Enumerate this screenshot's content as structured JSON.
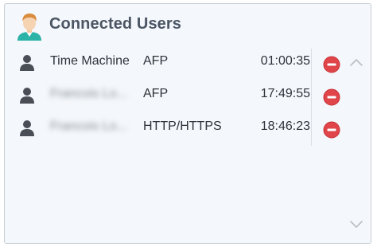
{
  "widget": {
    "title": "Connected Users"
  },
  "connections": [
    {
      "user": "Time Machine",
      "protocol": "AFP",
      "duration": "01:00:35",
      "blurred": false
    },
    {
      "user": "Francois Lo...",
      "protocol": "AFP",
      "duration": "17:49:55",
      "blurred": true
    },
    {
      "user": "Francois Lo...",
      "protocol": "HTTP/HTTPS",
      "duration": "18:46:23",
      "blurred": true
    }
  ],
  "icons": {
    "header": "user-avatar-icon",
    "row": "user-icon",
    "action": "disconnect-icon",
    "scroll_up": "chevron-up-icon",
    "scroll_down": "chevron-down-icon"
  },
  "colors": {
    "disconnect": "#e0454a",
    "avatar_shirt": "#2bb3a8",
    "title": "#4b5563"
  }
}
